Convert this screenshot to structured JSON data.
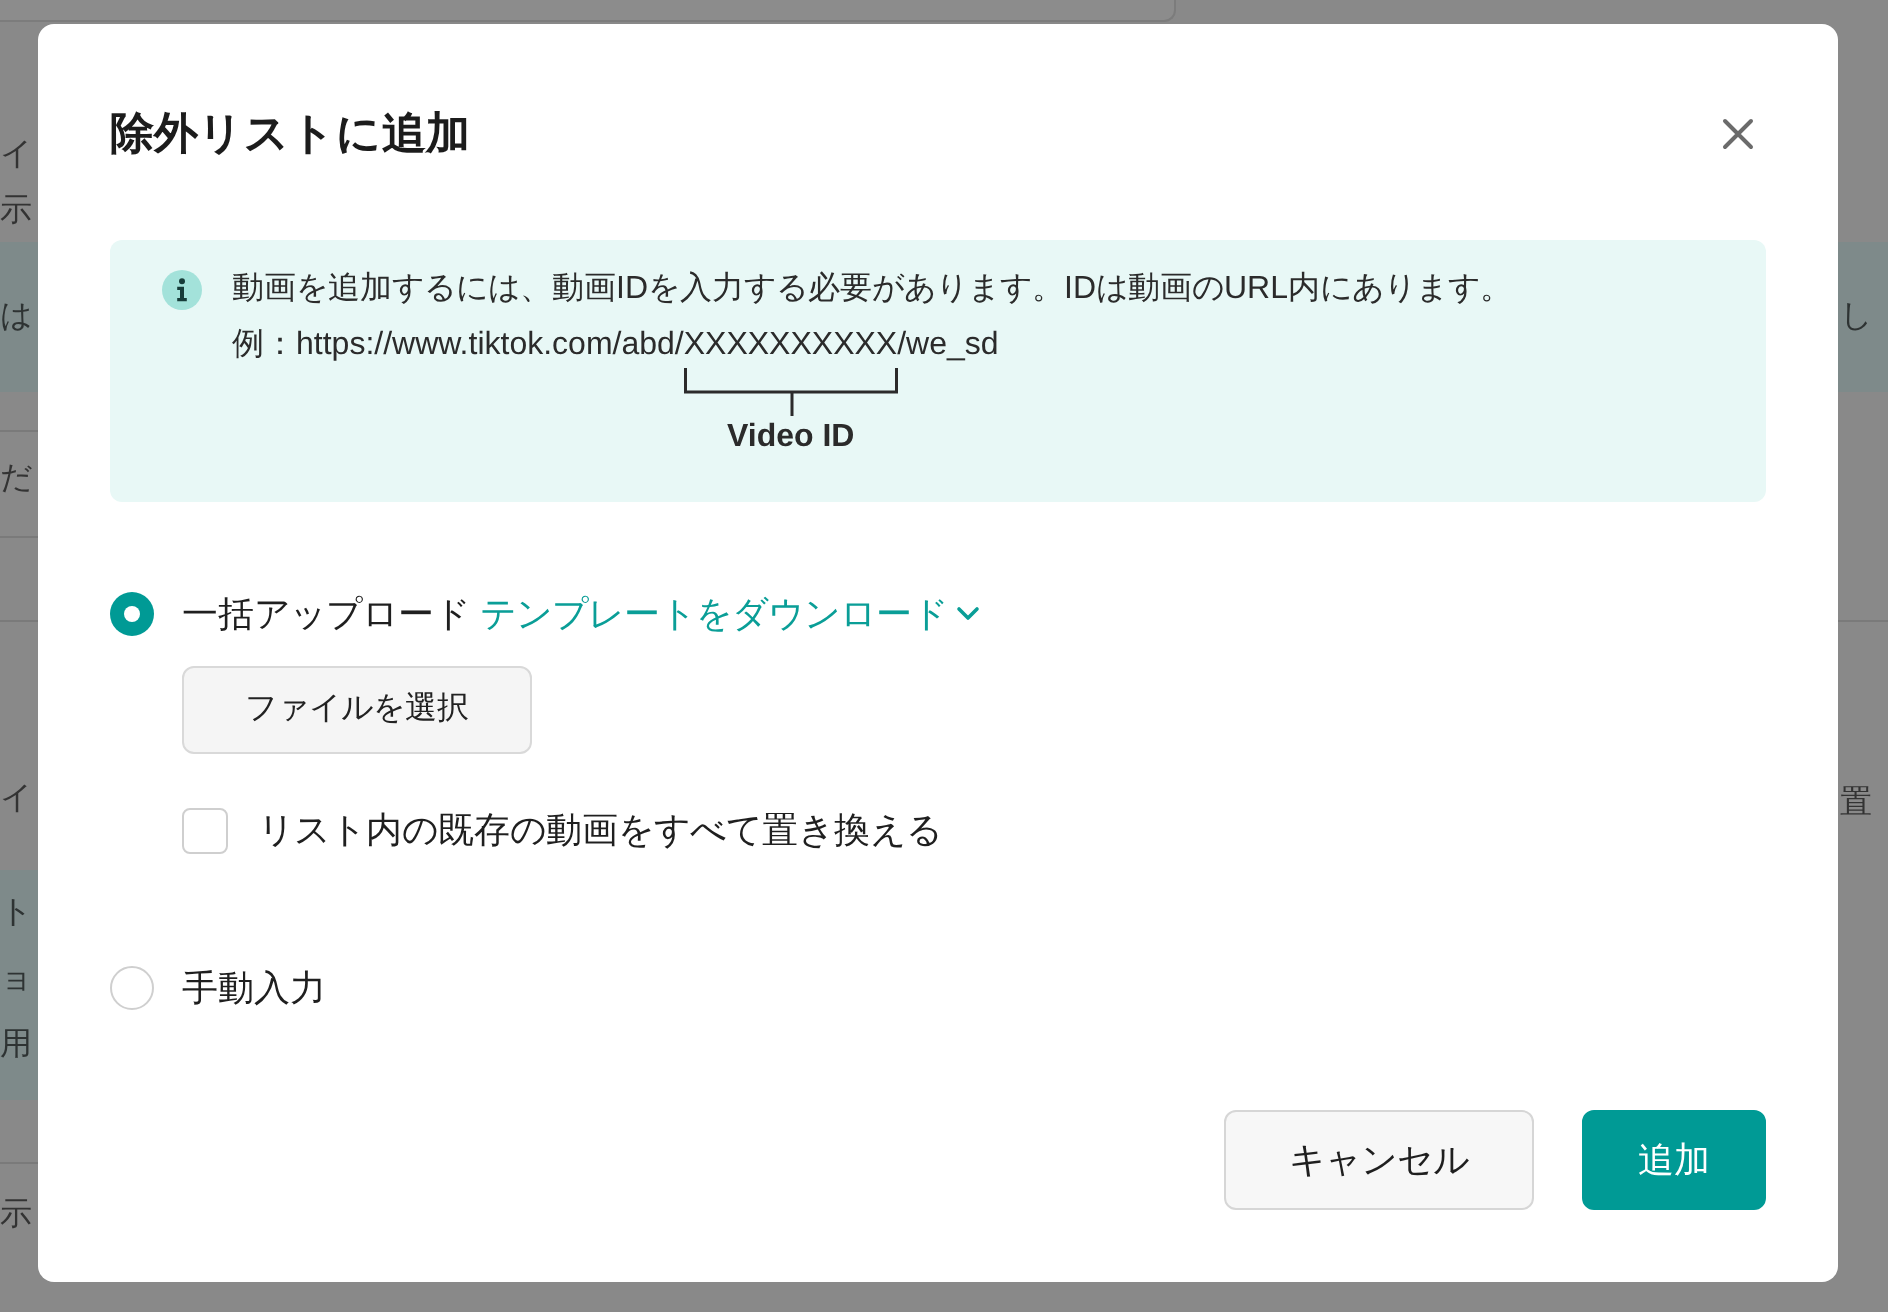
{
  "background": {
    "left": [
      {
        "kind": "text",
        "text": "イ"
      },
      {
        "kind": "text",
        "text": "示"
      },
      {
        "kind": "panel",
        "texts": [
          "は"
        ]
      },
      {
        "kind": "rule"
      },
      {
        "kind": "text",
        "text": "だ"
      },
      {
        "kind": "rule"
      },
      {
        "kind": "rule"
      },
      {
        "kind": "text",
        "text": "イ"
      },
      {
        "kind": "panel",
        "texts": [
          "ト",
          "ョ",
          "用"
        ]
      },
      {
        "kind": "rule"
      },
      {
        "kind": "text",
        "text": "示"
      }
    ],
    "right": [
      {
        "kind": "panel",
        "texts": [
          "し"
        ]
      },
      {
        "kind": "rule"
      },
      {
        "kind": "text",
        "text": "置"
      }
    ]
  },
  "dialog": {
    "title": "除外リストに追加"
  },
  "info": {
    "text": "動画を追加するには、動画IDを入力する必要があります。IDは動画のURL内にあります。",
    "example": {
      "prefix": "例：https://www.tiktok.com/abd/",
      "video_id": "XXXXXXXXXX",
      "suffix": "/we_sd"
    },
    "bracket_label": "Video ID"
  },
  "options": [
    {
      "kind": "bulk",
      "label": "一括アップロード",
      "selected": true,
      "link": "テンプレートをダウンロード",
      "file_button": "ファイルを選択",
      "checkbox": {
        "label": "リスト内の既存の動画をすべて置き換える",
        "checked": false
      }
    },
    {
      "kind": "manual",
      "label": "手動入力",
      "selected": false
    }
  ],
  "buttons": [
    {
      "kind": "secondary",
      "label": "キャンセル"
    },
    {
      "kind": "primary",
      "label": "追加"
    }
  ]
}
